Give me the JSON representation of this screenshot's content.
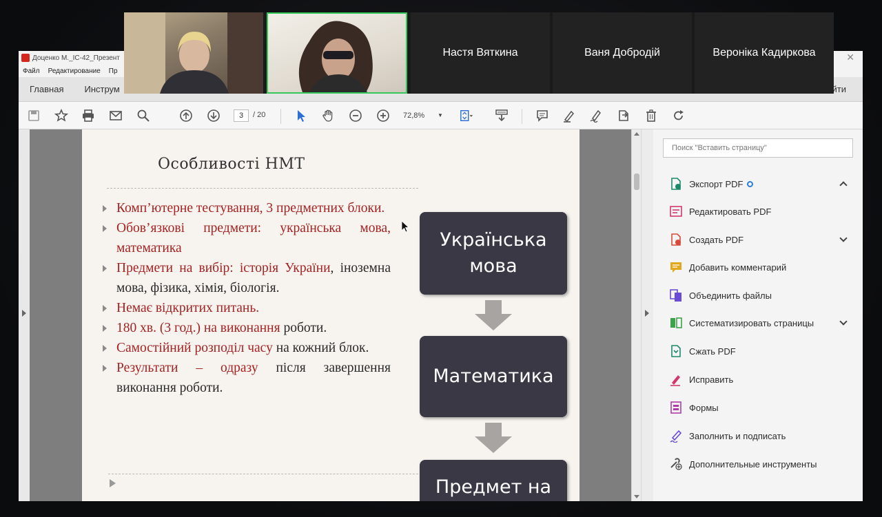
{
  "window": {
    "title": "Доценко М._ІС-42_Презент",
    "menu": [
      "Файл",
      "Редактирование",
      "Пр"
    ]
  },
  "nav": {
    "home": "Главная",
    "tools": "Инструм",
    "right": "йти"
  },
  "toolbar": {
    "page_current": "3",
    "page_total": "/ 20",
    "zoom": "72,8%"
  },
  "slide": {
    "title": "Особливості НМТ",
    "bullets": [
      {
        "red": "Комп’ютерне тестування, 3 предметних блоки.",
        "black": ""
      },
      {
        "red": "Обов’язкові предмети: українська мова, математика",
        "black": ""
      },
      {
        "red": "Предмети на вибір: історія України",
        "black": ", іноземна мова, фізика, хімія, біологія."
      },
      {
        "red": "Немає відкритих питань.",
        "black": ""
      },
      {
        "red": "180 хв. (3 год.) на виконання",
        "black": " роботи."
      },
      {
        "red": " Самостійний розподіл часу",
        "black": " на кожний блок."
      },
      {
        "red": "Результати – одразу",
        "black": " після завершення виконання роботи."
      }
    ],
    "flow": [
      "Українська мова",
      "Математика",
      "Предмет на вибір"
    ]
  },
  "right_panel": {
    "search_placeholder": "Поиск \"Вставить страницу\"",
    "tools": [
      {
        "label": "Экспорт PDF",
        "icon": "export-pdf-icon",
        "color": "#1a8a6a"
      },
      {
        "label": "Редактировать PDF",
        "icon": "edit-pdf-icon",
        "color": "#d2386c"
      },
      {
        "label": "Создать PDF",
        "icon": "create-pdf-icon",
        "color": "#d84a3a"
      },
      {
        "label": "Добавить комментарий",
        "icon": "comment-icon",
        "color": "#e0a81a"
      },
      {
        "label": "Объединить файлы",
        "icon": "combine-files-icon",
        "color": "#6a4bd6"
      },
      {
        "label": "Систематизировать страницы",
        "icon": "organize-pages-icon",
        "color": "#3ea24a"
      },
      {
        "label": "Сжать PDF",
        "icon": "compress-pdf-icon",
        "color": "#1a8a6a"
      },
      {
        "label": "Исправить",
        "icon": "redact-icon",
        "color": "#d2386c"
      },
      {
        "label": "Формы",
        "icon": "forms-icon",
        "color": "#b03aa8"
      },
      {
        "label": "Заполнить и подписать",
        "icon": "fill-sign-icon",
        "color": "#6a4bd6"
      },
      {
        "label": "Дополнительные инструменты",
        "icon": "more-tools-icon",
        "color": "#555555"
      }
    ]
  },
  "call": {
    "participants": [
      "Настя Вяткина",
      "Ваня Добродій",
      "Вероніка Кадиркова"
    ],
    "active_speaker_color": "#34c759"
  }
}
